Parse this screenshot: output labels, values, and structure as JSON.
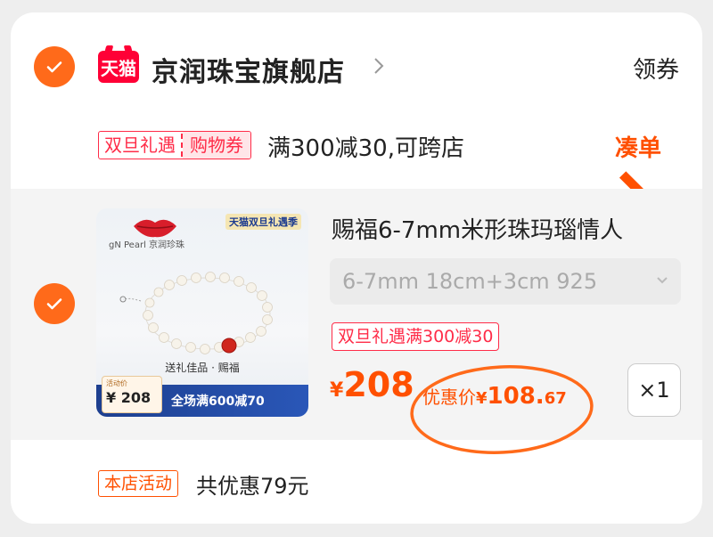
{
  "store": {
    "logo_text": "天猫",
    "name": "京润珠宝旗舰店",
    "coupon_label": "领券"
  },
  "promo": {
    "tag_left": "双旦礼遇",
    "tag_right": "购物券",
    "text": "满300减30,可跨店",
    "action_label": "凑单"
  },
  "item": {
    "image": {
      "badge": "天猫双旦礼遇季",
      "brand": "gN Pearl 京润珍珠",
      "caption": "送礼佳品 · 赐福",
      "price_box_label": "活动价",
      "price_box_value": "¥ 208",
      "bottom_text": "全场满600减70"
    },
    "title": "赐福6-7mm米形珠玛瑙情人",
    "spec": "6-7mm 18cm+3cm  925",
    "promo_tag": "双旦礼遇满300减30",
    "price_symbol": "¥",
    "price": "208",
    "discount_label": "优惠价",
    "discount_symbol": "¥",
    "discount_int": "108.",
    "discount_dec": "67",
    "quantity": "×1"
  },
  "summary": {
    "tag": "本店活动",
    "text": "共优惠79元"
  },
  "colors": {
    "accent": "#ff5000",
    "check": "#ff6a1a",
    "promo_red": "#ff2c48",
    "tmall_red": "#ff0036"
  }
}
